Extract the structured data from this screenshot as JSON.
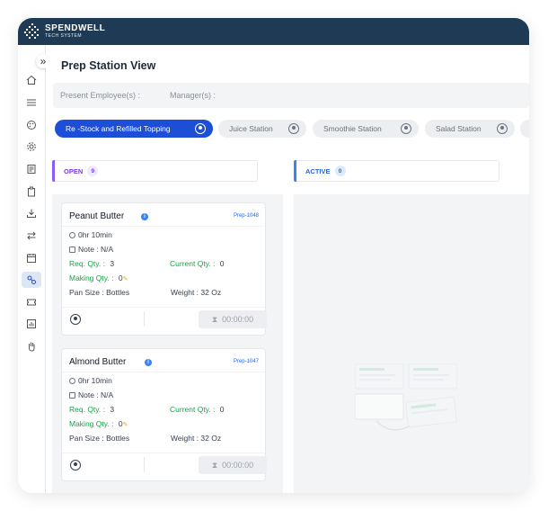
{
  "brand": {
    "name": "SPENDWELL",
    "tagline": "TECH SYSTEM"
  },
  "sidebar": {
    "expand_label": "»",
    "items": [
      {
        "icon": "home-icon"
      },
      {
        "icon": "menu-icon"
      },
      {
        "icon": "palette-icon"
      },
      {
        "icon": "settings-icon"
      },
      {
        "icon": "report-icon"
      },
      {
        "icon": "clipboard-icon"
      },
      {
        "icon": "download-icon"
      },
      {
        "icon": "transfer-icon"
      },
      {
        "icon": "calendar-icon"
      },
      {
        "icon": "prep-station-icon",
        "active": true
      },
      {
        "icon": "ticket-icon"
      },
      {
        "icon": "chart-icon"
      },
      {
        "icon": "hand-icon"
      }
    ]
  },
  "page": {
    "title": "Prep Station View",
    "present_employees_label": "Present Employee(s) :",
    "managers_label": "Manager(s) :"
  },
  "tabs": [
    {
      "label": "Re -Stock and Refilled Topping",
      "active": true
    },
    {
      "label": "Juice Station"
    },
    {
      "label": "Smoothie Station"
    },
    {
      "label": "Salad Station"
    }
  ],
  "columns": {
    "open": {
      "label": "OPEN",
      "count": "9",
      "color": "#8b5cf6"
    },
    "active": {
      "label": "ACTIVE",
      "count": "0",
      "color": "#3b82f6"
    }
  },
  "cards": [
    {
      "name": "Peanut Butter",
      "prep_id": "Prep-1048",
      "duration": "0hr 10min",
      "note": "Note : N/A",
      "req_qty_label": "Req. Qty. :",
      "req_qty": "3",
      "current_qty_label": "Current Qty. :",
      "current_qty": "0",
      "making_qty_label": "Making Qty. :",
      "making_qty": "0",
      "pan_size": "Pan Size : Bottles",
      "weight": "Weight : 32 Oz",
      "timer": "00:00:00"
    },
    {
      "name": "Almond Butter",
      "prep_id": "Prep-1047",
      "duration": "0hr 10min",
      "note": "Note : N/A",
      "req_qty_label": "Req. Qty. :",
      "req_qty": "3",
      "current_qty_label": "Current Qty. :",
      "current_qty": "0",
      "making_qty_label": "Making Qty. :",
      "making_qty": "0",
      "pan_size": "Pan Size : Bottles",
      "weight": "Weight : 32 Oz",
      "timer": "00:00:00"
    }
  ],
  "colors": {
    "topbar": "#1e3a55",
    "primary": "#1d4ed8",
    "green": "#16a34a"
  }
}
